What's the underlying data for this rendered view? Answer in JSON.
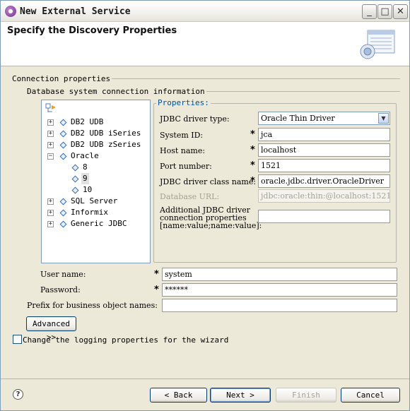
{
  "window": {
    "title": "New External Service",
    "controls": {
      "minimize": "_",
      "maximize": "□",
      "close": "✕"
    }
  },
  "header": {
    "title": "Specify the Discovery Properties"
  },
  "connection": {
    "group_label": "Connection properties",
    "db_group_label": "Database system connection information"
  },
  "tree": {
    "items": [
      {
        "label": "DB2 UDB",
        "expander": "+"
      },
      {
        "label": "DB2 UDB iSeries",
        "expander": "+"
      },
      {
        "label": "DB2 UDB zSeries",
        "expander": "+"
      },
      {
        "label": "Oracle",
        "expander": "−"
      },
      {
        "label": "8"
      },
      {
        "label": "9",
        "selected": true
      },
      {
        "label": "10"
      },
      {
        "label": "SQL Server",
        "expander": "+"
      },
      {
        "label": "Informix",
        "expander": "+"
      },
      {
        "label": "Generic JDBC",
        "expander": "+"
      }
    ]
  },
  "properties": {
    "legend": "Properties:",
    "driver_type_label": "JDBC driver type:",
    "driver_type_value": "Oracle Thin Driver",
    "system_id_label": "System ID:",
    "system_id_value": "jca",
    "host_label": "Host name:",
    "host_value": "localhost",
    "port_label": "Port number:",
    "port_value": "1521",
    "class_label": "JDBC driver class name:",
    "class_value": "oracle.jdbc.driver.OracleDriver",
    "url_label": "Database URL:",
    "url_value": "jdbc:oracle:thin:@localhost:1521",
    "additional_label_1": "Additional JDBC driver",
    "additional_label_2": "connection properties",
    "additional_label_3": "[name:value;name:value]:",
    "additional_value": "",
    "required_mark": "*"
  },
  "credentials": {
    "user_label": "User name:",
    "user_value": "system",
    "password_label": "Password:",
    "password_value": "******",
    "prefix_label": "Prefix for business object names:",
    "prefix_value": ""
  },
  "advanced_button": "Advanced >>",
  "logging_checkbox_label": "Change the logging properties for the wizard",
  "footer": {
    "help": "?",
    "back": "< Back",
    "next": "Next >",
    "finish": "Finish",
    "cancel": "Cancel"
  }
}
